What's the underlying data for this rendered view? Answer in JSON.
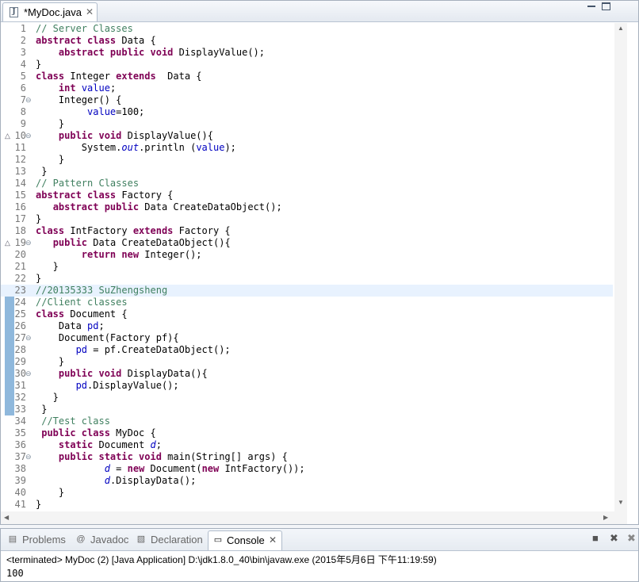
{
  "editor": {
    "tab_title": "*MyDoc.java",
    "tab_close": "✕",
    "file_icon_glyph": "J",
    "lines": [
      {
        "n": "1",
        "h": "<span class=\"cm\">// Server Classes</span>"
      },
      {
        "n": "2",
        "h": "<span class=\"kw\">abstract class</span> Data {"
      },
      {
        "n": "3",
        "h": "    <span class=\"kw\">abstract public void</span> DisplayValue();"
      },
      {
        "n": "4",
        "h": "}"
      },
      {
        "n": "5",
        "h": "<span class=\"kw\">class</span> Integer <span class=\"kw\">extends</span>  Data {"
      },
      {
        "n": "6",
        "h": "    <span class=\"kw\">int</span> <span class=\"fd\">value</span>;"
      },
      {
        "n": "7",
        "h": "    Integer() {",
        "fold": true
      },
      {
        "n": "8",
        "h": "         <span class=\"fd\">value</span>=100;"
      },
      {
        "n": "9",
        "h": "    }"
      },
      {
        "n": "10",
        "h": "    <span class=\"kw\">public void</span> DisplayValue(){",
        "fold": true,
        "ovr": true
      },
      {
        "n": "11",
        "h": "        System.<span class=\"st\">out</span>.println (<span class=\"fd\">value</span>);"
      },
      {
        "n": "12",
        "h": "    }"
      },
      {
        "n": "13",
        "h": " }"
      },
      {
        "n": "14",
        "h": "<span class=\"cm\">// Pattern Classes</span>"
      },
      {
        "n": "15",
        "h": "<span class=\"kw\">abstract class</span> Factory {"
      },
      {
        "n": "16",
        "h": "   <span class=\"kw\">abstract public</span> Data CreateDataObject();"
      },
      {
        "n": "17",
        "h": "}"
      },
      {
        "n": "18",
        "h": "<span class=\"kw\">class</span> IntFactory <span class=\"kw\">extends</span> Factory {"
      },
      {
        "n": "19",
        "h": "   <span class=\"kw\">public</span> Data CreateDataObject(){",
        "fold": true,
        "ovr": true
      },
      {
        "n": "20",
        "h": "        <span class=\"kw\">return new</span> Integer();"
      },
      {
        "n": "21",
        "h": "   }"
      },
      {
        "n": "22",
        "h": "}"
      },
      {
        "n": "23",
        "h": "<span class=\"cm\">//20135333 SuZhengsheng</span>",
        "hl": true
      },
      {
        "n": "24",
        "h": "<span class=\"cm\">//Client classes</span>"
      },
      {
        "n": "25",
        "h": "<span class=\"kw\">class</span> Document {"
      },
      {
        "n": "26",
        "h": "    Data <span class=\"fd\">pd</span>;"
      },
      {
        "n": "27",
        "h": "    Document(Factory pf){",
        "fold": true
      },
      {
        "n": "28",
        "h": "       <span class=\"fd\">pd</span> = pf.CreateDataObject();"
      },
      {
        "n": "29",
        "h": "    }"
      },
      {
        "n": "30",
        "h": "    <span class=\"kw\">public void</span> DisplayData(){",
        "fold": true
      },
      {
        "n": "31",
        "h": "       <span class=\"fd\">pd</span>.DisplayValue();"
      },
      {
        "n": "32",
        "h": "   }"
      },
      {
        "n": "33",
        "h": " }"
      },
      {
        "n": "34",
        "h": " <span class=\"cm\">//Test class</span>"
      },
      {
        "n": "35",
        "h": " <span class=\"kw\">public class</span> MyDoc {"
      },
      {
        "n": "36",
        "h": "    <span class=\"kw\">static</span> Document <span class=\"st\">d</span>;"
      },
      {
        "n": "37",
        "h": "    <span class=\"kw\">public static void</span> main(String[] args) {",
        "fold": true
      },
      {
        "n": "38",
        "h": "            <span class=\"st\">d</span> = <span class=\"kw\">new</span> Document(<span class=\"kw\">new</span> IntFactory());"
      },
      {
        "n": "39",
        "h": "            <span class=\"st\">d</span>.DisplayData();"
      },
      {
        "n": "40",
        "h": "    }"
      },
      {
        "n": "41",
        "h": "}"
      }
    ]
  },
  "panel": {
    "tabs": [
      {
        "label": "Problems",
        "icon": "problems-icon",
        "glyph": "▤"
      },
      {
        "label": "Javadoc",
        "icon": "javadoc-icon",
        "glyph": "@"
      },
      {
        "label": "Declaration",
        "icon": "declaration-icon",
        "glyph": "▧"
      },
      {
        "label": "Console",
        "icon": "console-icon",
        "glyph": "▭",
        "active": true
      }
    ],
    "console_close": "✕",
    "status": "<terminated> MyDoc (2) [Java Application] D:\\jdk1.8.0_40\\bin\\javaw.exe (2015年5月6日 下午11:19:59)",
    "output": "100",
    "tools": {
      "stop": "■",
      "remove": "✖",
      "remove_all": "✖"
    }
  },
  "colors": {
    "keyword": "#7f0055",
    "comment": "#3f7f5f",
    "field": "#0000c0",
    "highlight": "#e8f2fe",
    "gutter_mark": "#8fb8dc"
  }
}
